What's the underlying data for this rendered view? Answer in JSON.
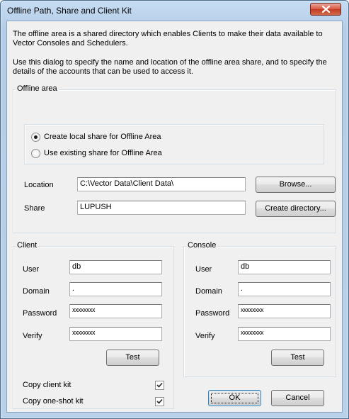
{
  "window": {
    "title": "Offline Path, Share and Client Kit"
  },
  "intro": {
    "line1": "The offline area is a shared directory which enables Clients to make their data available to",
    "line2": "Vector Consoles and Schedulers.",
    "line3": "Use this dialog to specify the name and location of the offline area share, and to specify the",
    "line4": "details of the accounts that can be used to access it."
  },
  "offline_area": {
    "title": "Offline area",
    "radio_create_label": "Create local share for Offline Area",
    "radio_existing_label": "Use existing share for Offline Area",
    "selected": "create",
    "location_label": "Location",
    "location_value": "C:\\Vector Data\\Client Data\\",
    "browse_label": "Browse...",
    "share_label": "Share",
    "share_value": "LUPUSH",
    "create_dir_label": "Create directory..."
  },
  "client": {
    "title": "Client",
    "user_label": "User",
    "user_value": "db",
    "domain_label": "Domain",
    "domain_value": ".",
    "password_label": "Password",
    "password_value": "xxxxxxxx",
    "verify_label": "Verify",
    "verify_value": "xxxxxxxx",
    "test_label": "Test",
    "copy_client_kit_label": "Copy client kit",
    "copy_client_kit_checked": true,
    "copy_oneshot_kit_label": "Copy one-shot kit",
    "copy_oneshot_kit_checked": true
  },
  "console": {
    "title": "Console",
    "user_label": "User",
    "user_value": "db",
    "domain_label": "Domain",
    "domain_value": ".",
    "password_label": "Password",
    "password_value": "xxxxxxxx",
    "verify_label": "Verify",
    "verify_value": "xxxxxxxx",
    "test_label": "Test"
  },
  "footer": {
    "ok_label": "OK",
    "cancel_label": "Cancel"
  },
  "icons": {
    "close": "close-icon",
    "check": "checkmark-icon"
  },
  "colors": {
    "close_button": "#c33a22",
    "title_bar": "#b9d1ea",
    "dialog_bg": "#f0f0f0"
  }
}
